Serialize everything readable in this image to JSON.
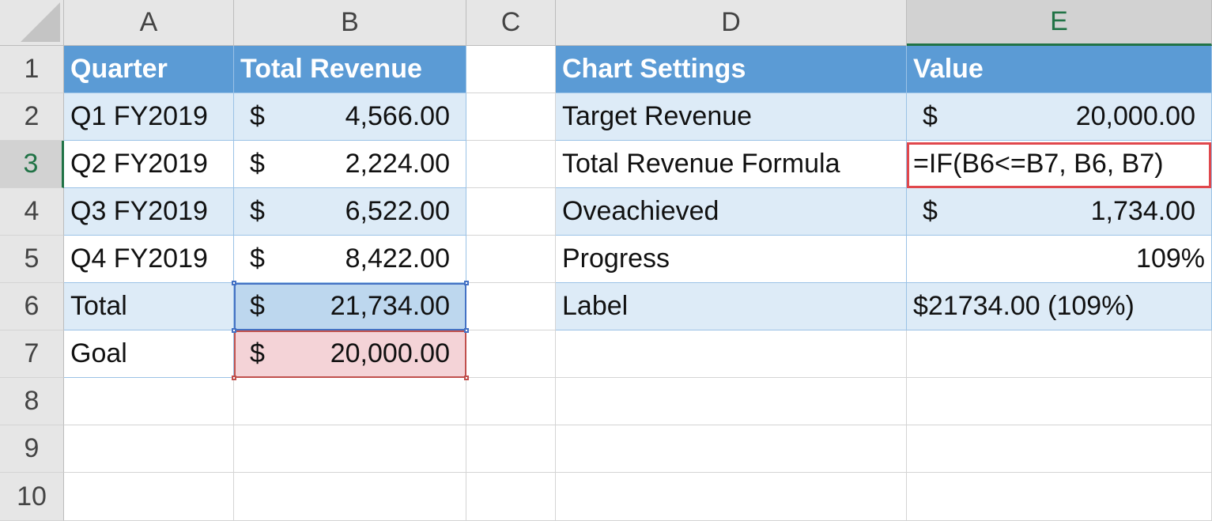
{
  "columns": [
    "A",
    "B",
    "C",
    "D",
    "E"
  ],
  "rows": [
    "1",
    "2",
    "3",
    "4",
    "5",
    "6",
    "7",
    "8",
    "9",
    "10"
  ],
  "currency_symbol": "$",
  "table_revenue": {
    "header": {
      "quarter": "Quarter",
      "total_revenue": "Total Revenue"
    },
    "rows": [
      {
        "quarter": "Q1 FY2019",
        "amount": "4,566.00"
      },
      {
        "quarter": "Q2 FY2019",
        "amount": "2,224.00"
      },
      {
        "quarter": "Q3 FY2019",
        "amount": "6,522.00"
      },
      {
        "quarter": "Q4 FY2019",
        "amount": "8,422.00"
      },
      {
        "quarter": "Total",
        "amount": "21,734.00"
      },
      {
        "quarter": "Goal",
        "amount": "20,000.00"
      }
    ]
  },
  "chart_settings": {
    "header": {
      "setting": "Chart Settings",
      "value": "Value"
    },
    "target_revenue": {
      "label": "Target Revenue",
      "value": "20,000.00"
    },
    "total_revenue_formula": {
      "label": "Total Revenue Formula",
      "value": "=IF(B6<=B7, B6, B7)"
    },
    "overachieved": {
      "label": "Oveachieved",
      "value": "1,734.00"
    },
    "progress": {
      "label": "Progress",
      "value": "109%"
    },
    "label_row": {
      "label": "Label",
      "value": "$21734.00 (109%)"
    }
  },
  "colors": {
    "header_fill": "#5b9bd5",
    "band_fill": "#ddebf7",
    "selected_total": "#bdd7ee",
    "selected_goal": "#f4d3d7",
    "highlight_box": "#e0474c",
    "active_header": "#217346"
  }
}
